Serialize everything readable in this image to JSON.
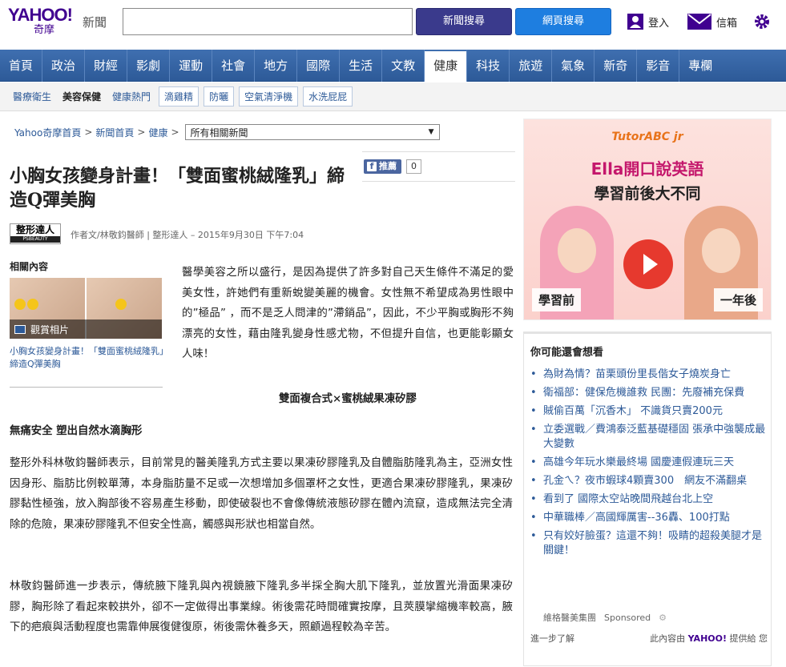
{
  "header": {
    "logo_main": "YAHOO!",
    "logo_sub": "奇摩",
    "logo_news": "新聞",
    "search_value": "",
    "btn_news": "新聞搜尋",
    "btn_web": "網頁搜尋",
    "login": "登入",
    "mail": "信箱",
    "colors": {
      "brand": "#400090",
      "nav": "#3f6fb0",
      "btn_news": "#3a3a8c",
      "btn_web": "#1e7ee0"
    }
  },
  "nav": {
    "items": [
      "首頁",
      "政治",
      "財經",
      "影劇",
      "運動",
      "社會",
      "地方",
      "國際",
      "生活",
      "文教",
      "健康",
      "科技",
      "旅遊",
      "氣象",
      "新奇",
      "影音",
      "專欄"
    ],
    "active_index": 10
  },
  "subnav": {
    "links": [
      "醫療衛生",
      "美容保健",
      "健康熱門"
    ],
    "tags": [
      "滴雞精",
      "防曬",
      "空氣清淨機",
      "水洗屁屁"
    ]
  },
  "breadcrumb": {
    "items": [
      "Yahoo奇摩首頁",
      "新聞首頁",
      "健康"
    ],
    "sep": ">",
    "select_value": "所有相關新聞"
  },
  "article": {
    "title": "小胸女孩變身計畫！「雙面蜜桃絨隆乳」締造Q彈美胸",
    "fb_label": "推薦",
    "fb_count": "0",
    "source_logo": "整形達人",
    "source_logo_sub": "PSBEAUTY",
    "byline": "作者文/林敬鈞醫師 | 整形達人 – 2015年9月30日 下午7:04",
    "p1": "醫學美容之所以盛行，是因為提供了許多對自己天生條件不滿足的愛美女性，許她們有重新蛻變美麗的機會。女性無不希望成為男性眼中的”極品” ，而不是乏人問津的”滯銷品”，因此，不少平胸或胸形不夠漂亮的女性，藉由隆乳變身性感尤物，不但提升自信，也更能彰顯女人味！",
    "sub1": "雙面複合式×蜜桃絨果凍矽膠",
    "sub2": "無痛安全 塑出自然水滴胸形",
    "p2": "整形外科林敬鈞醫師表示，目前常見的醫美隆乳方式主要以果凍矽膠隆乳及自體脂肪隆乳為主，亞洲女性因身形、脂肪比例較單薄，本身脂肪量不足或一次想增加多個罩杯之女性，更適合果凍矽膠隆乳，果凍矽膠黏性極強，放入胸部後不容易產生移動，即使破裂也不會像傳統液態矽膠在體內流竄，造成無法完全清除的危險，果凍矽膠隆乳不但安全性高，觸感與形狀也相當自然。",
    "p3": "林敬鈞醫師進一步表示，傳統腋下隆乳與內視鏡腋下隆乳多半採全胸大肌下隆乳，並放置光滑面果凍矽膠，胸形除了看起來較拱外，卻不一定做得出事業線。術後需花時間確實按摩，且莢膜攣縮機率較高，腋下的疤痕與活動程度也需靠伸展復健復原，術後需休養多天，照顧過程較為辛苦。"
  },
  "related": {
    "heading": "相關內容",
    "gallery": "觀賞相片",
    "caption": "小胸女孩變身計畫！「雙面蜜桃絨隆乳」締造Q彈美胸"
  },
  "ad": {
    "brand": "TutorABC jr",
    "line1": "Ella開口說英語",
    "line2": "學習前後大不同",
    "before": "學習前",
    "after": "一年後"
  },
  "recommend": {
    "heading": "你可能還會想看",
    "items": [
      "為財為情？苗栗頭份里長偕女子燒炭身亡",
      "衛福部：健保危機誰救 民團：先廢補充保費",
      "賊偷百萬「沉香木」 不識貨只賣200元",
      "立委選戰／費鴻泰泛藍基礎穩固 張承中強襲成最大變數",
      "高雄今年玩水樂最終場 國慶連假連玩三天",
      "孔金ㄟ？夜市蝦球4顆賣300　網友不滿翻桌",
      "看到了 國際太空站晚間飛越台北上空",
      "中華職棒／高國輝厲害--36轟、100打點",
      "只有姣好臉蛋？這還不夠！吸睛的超殺美腿才是關鍵！"
    ],
    "sponsor_name": "維格醫美集團",
    "sponsored": "Sponsored",
    "more": "進一步了解",
    "provided_prefix": "此內容由",
    "provided_brand": "YAHOO!",
    "provided_suffix": "提供給 您"
  }
}
